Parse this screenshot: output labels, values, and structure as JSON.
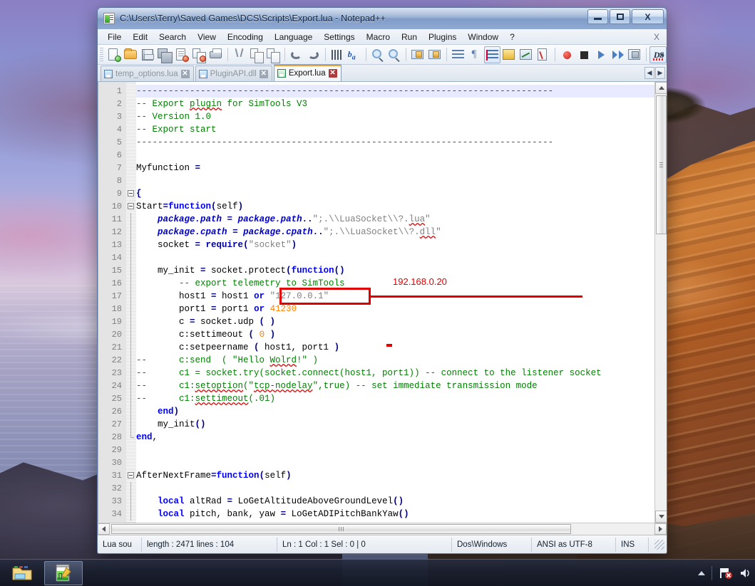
{
  "window": {
    "title": "C:\\Users\\Terry\\Saved Games\\DCS\\Scripts\\Export.lua - Notepad++",
    "doc_icon": "notepad-plus-plus-document-icon",
    "minimize": "–",
    "maximize": "❑",
    "close": "X"
  },
  "menu": {
    "items": [
      {
        "label": "File"
      },
      {
        "label": "Edit"
      },
      {
        "label": "Search"
      },
      {
        "label": "View"
      },
      {
        "label": "Encoding"
      },
      {
        "label": "Language"
      },
      {
        "label": "Settings"
      },
      {
        "label": "Macro"
      },
      {
        "label": "Run"
      },
      {
        "label": "Plugins"
      },
      {
        "label": "Window"
      },
      {
        "label": "?"
      }
    ],
    "close_doc": "X"
  },
  "toolbar": {
    "overflow": "»",
    "buttons": [
      {
        "name": "new-file-icon"
      },
      {
        "name": "open-file-icon"
      },
      {
        "name": "save-icon"
      },
      {
        "name": "save-all-icon"
      },
      {
        "name": "close-file-icon"
      },
      {
        "name": "close-all-files-icon"
      },
      {
        "name": "print-icon"
      },
      {
        "name": "cut-icon"
      },
      {
        "name": "copy-icon"
      },
      {
        "name": "paste-icon"
      },
      {
        "name": "undo-icon"
      },
      {
        "name": "redo-icon"
      },
      {
        "name": "find-icon"
      },
      {
        "name": "replace-icon"
      },
      {
        "name": "zoom-in-icon"
      },
      {
        "name": "zoom-out-icon"
      },
      {
        "name": "sync-vertical-scroll-icon"
      },
      {
        "name": "sync-horizontal-scroll-icon"
      },
      {
        "name": "word-wrap-icon"
      },
      {
        "name": "show-all-characters-icon"
      },
      {
        "name": "indent-guide-icon"
      },
      {
        "name": "user-defined-dialog-icon"
      },
      {
        "name": "document-map-icon"
      },
      {
        "name": "function-list-icon"
      },
      {
        "name": "start-recording-icon"
      },
      {
        "name": "stop-recording-icon"
      },
      {
        "name": "play-macro-icon"
      },
      {
        "name": "run-macro-multiple-icon"
      },
      {
        "name": "save-macro-icon"
      },
      {
        "name": "ds-plugin-icon"
      }
    ],
    "ds_label": "DS"
  },
  "tabs": {
    "items": [
      {
        "label": "temp_options.lua",
        "active": false,
        "close": "✕"
      },
      {
        "label": "PluginAPI.dll",
        "active": false,
        "close": "✕"
      },
      {
        "label": "Export.lua",
        "active": true,
        "close": "✕"
      }
    ],
    "nav_prev": "◀",
    "nav_next": "▶"
  },
  "editor": {
    "first_line": 1,
    "caret_line": 1,
    "lines": [
      {
        "n": 1,
        "fold": "none",
        "tokens": [
          {
            "t": "comment",
            "s": "------------------------------------------------------------------------------"
          }
        ]
      },
      {
        "n": 2,
        "fold": "none",
        "tokens": [
          {
            "t": "comment",
            "s": "-- Export "
          },
          {
            "t": "comment-spell",
            "s": "plugin"
          },
          {
            "t": "comment",
            "s": " for SimTools V3"
          }
        ]
      },
      {
        "n": 3,
        "fold": "none",
        "tokens": [
          {
            "t": "comment",
            "s": "-- Version 1.0"
          }
        ]
      },
      {
        "n": 4,
        "fold": "none",
        "tokens": [
          {
            "t": "comment",
            "s": "-- Export start"
          }
        ]
      },
      {
        "n": 5,
        "fold": "none",
        "tokens": [
          {
            "t": "comment",
            "s": "------------------------------------------------------------------------------"
          }
        ]
      },
      {
        "n": 6,
        "fold": "none",
        "tokens": []
      },
      {
        "n": 7,
        "fold": "none",
        "tokens": [
          {
            "t": "plain",
            "s": "Myfunction "
          },
          {
            "t": "op",
            "s": "="
          }
        ]
      },
      {
        "n": 8,
        "fold": "none",
        "tokens": []
      },
      {
        "n": 9,
        "fold": "open",
        "tokens": [
          {
            "t": "op",
            "s": "{"
          }
        ]
      },
      {
        "n": 10,
        "fold": "open",
        "tokens": [
          {
            "t": "plain",
            "s": "Start"
          },
          {
            "t": "op",
            "s": "="
          },
          {
            "t": "keyword",
            "s": "function"
          },
          {
            "t": "op",
            "s": "("
          },
          {
            "t": "plain",
            "s": "self"
          },
          {
            "t": "op",
            "s": ")"
          }
        ]
      },
      {
        "n": 11,
        "fold": "line",
        "tokens": [
          {
            "t": "plain",
            "s": "    "
          },
          {
            "t": "ident-bi",
            "s": "package.path"
          },
          {
            "t": "plain",
            "s": " "
          },
          {
            "t": "op",
            "s": "="
          },
          {
            "t": "plain",
            "s": " "
          },
          {
            "t": "ident-bi",
            "s": "package.path"
          },
          {
            "t": "op",
            "s": ".."
          },
          {
            "t": "str",
            "s": "\";.\\\\LuaSocket\\\\?."
          },
          {
            "t": "str-spell",
            "s": "lua"
          },
          {
            "t": "str",
            "s": "\""
          }
        ]
      },
      {
        "n": 12,
        "fold": "line",
        "tokens": [
          {
            "t": "plain",
            "s": "    "
          },
          {
            "t": "ident-bi",
            "s": "package.cpath"
          },
          {
            "t": "plain",
            "s": " "
          },
          {
            "t": "op",
            "s": "="
          },
          {
            "t": "plain",
            "s": " "
          },
          {
            "t": "ident-bi",
            "s": "package.cpath"
          },
          {
            "t": "op",
            "s": ".."
          },
          {
            "t": "str",
            "s": "\";.\\\\LuaSocket\\\\?."
          },
          {
            "t": "str-spell",
            "s": "dll"
          },
          {
            "t": "str",
            "s": "\""
          }
        ]
      },
      {
        "n": 13,
        "fold": "line",
        "tokens": [
          {
            "t": "plain",
            "s": "    socket "
          },
          {
            "t": "op",
            "s": "="
          },
          {
            "t": "plain",
            "s": " "
          },
          {
            "t": "func",
            "s": "require"
          },
          {
            "t": "op",
            "s": "("
          },
          {
            "t": "str",
            "s": "\"socket\""
          },
          {
            "t": "op",
            "s": ")"
          }
        ]
      },
      {
        "n": 14,
        "fold": "line",
        "tokens": []
      },
      {
        "n": 15,
        "fold": "line",
        "tokens": [
          {
            "t": "plain",
            "s": "    my_init "
          },
          {
            "t": "op",
            "s": "="
          },
          {
            "t": "plain",
            "s": " socket.protect"
          },
          {
            "t": "op",
            "s": "("
          },
          {
            "t": "keyword",
            "s": "function"
          },
          {
            "t": "op",
            "s": "()"
          }
        ]
      },
      {
        "n": 16,
        "fold": "line",
        "tokens": [
          {
            "t": "plain",
            "s": "        "
          },
          {
            "t": "comment",
            "s": "-- export telemetry to SimTools"
          }
        ]
      },
      {
        "n": 17,
        "fold": "line",
        "tokens": [
          {
            "t": "plain",
            "s": "        host1 "
          },
          {
            "t": "op",
            "s": "="
          },
          {
            "t": "plain",
            "s": " host1 "
          },
          {
            "t": "keyword",
            "s": "or"
          },
          {
            "t": "plain",
            "s": " "
          },
          {
            "t": "str",
            "s": "\"127.0.0.1\""
          }
        ]
      },
      {
        "n": 18,
        "fold": "line",
        "tokens": [
          {
            "t": "plain",
            "s": "        port1 "
          },
          {
            "t": "op",
            "s": "="
          },
          {
            "t": "plain",
            "s": " port1 "
          },
          {
            "t": "keyword",
            "s": "or"
          },
          {
            "t": "plain",
            "s": " "
          },
          {
            "t": "num",
            "s": "41230"
          }
        ]
      },
      {
        "n": 19,
        "fold": "line",
        "tokens": [
          {
            "t": "plain",
            "s": "        c "
          },
          {
            "t": "op",
            "s": "="
          },
          {
            "t": "plain",
            "s": " socket.udp "
          },
          {
            "t": "op",
            "s": "( )"
          }
        ]
      },
      {
        "n": 20,
        "fold": "line",
        "tokens": [
          {
            "t": "plain",
            "s": "        c:settimeout "
          },
          {
            "t": "op",
            "s": "("
          },
          {
            "t": "plain",
            "s": " "
          },
          {
            "t": "num",
            "s": "0"
          },
          {
            "t": "plain",
            "s": " "
          },
          {
            "t": "op",
            "s": ")"
          }
        ]
      },
      {
        "n": 21,
        "fold": "line",
        "tokens": [
          {
            "t": "plain",
            "s": "        c:setpeername "
          },
          {
            "t": "op",
            "s": "("
          },
          {
            "t": "plain",
            "s": " host1, port1 "
          },
          {
            "t": "op",
            "s": ")"
          }
        ]
      },
      {
        "n": 22,
        "fold": "line",
        "tokens": [
          {
            "t": "comment",
            "s": "--      c:send  ( \"Hello "
          },
          {
            "t": "comment-spell",
            "s": "Wolrd"
          },
          {
            "t": "comment",
            "s": "!\" )"
          }
        ]
      },
      {
        "n": 23,
        "fold": "line",
        "tokens": [
          {
            "t": "comment",
            "s": "--      c1 = socket.try(socket.connect(host1, port1)) -- connect to the listener socket"
          }
        ]
      },
      {
        "n": 24,
        "fold": "line",
        "tokens": [
          {
            "t": "comment",
            "s": "--      c1:"
          },
          {
            "t": "comment-spell",
            "s": "setoption"
          },
          {
            "t": "comment",
            "s": "(\""
          },
          {
            "t": "comment-spell",
            "s": "tcp-nodelay"
          },
          {
            "t": "comment",
            "s": "\",true) -- set immediate transmission mode"
          }
        ]
      },
      {
        "n": 25,
        "fold": "line",
        "tokens": [
          {
            "t": "comment",
            "s": "--      c1:"
          },
          {
            "t": "comment-spell",
            "s": "settimeout"
          },
          {
            "t": "comment",
            "s": "(.01)"
          }
        ]
      },
      {
        "n": 26,
        "fold": "line",
        "tokens": [
          {
            "t": "plain",
            "s": "    "
          },
          {
            "t": "keyword",
            "s": "end"
          },
          {
            "t": "op",
            "s": ")"
          }
        ]
      },
      {
        "n": 27,
        "fold": "line",
        "tokens": [
          {
            "t": "plain",
            "s": "    my_init"
          },
          {
            "t": "op",
            "s": "()"
          }
        ]
      },
      {
        "n": 28,
        "fold": "end",
        "tokens": [
          {
            "t": "keyword",
            "s": "end"
          },
          {
            "t": "plain",
            "s": ","
          }
        ]
      },
      {
        "n": 29,
        "fold": "none",
        "tokens": []
      },
      {
        "n": 30,
        "fold": "none",
        "tokens": []
      },
      {
        "n": 31,
        "fold": "open",
        "tokens": [
          {
            "t": "plain",
            "s": "AfterNextFrame"
          },
          {
            "t": "op",
            "s": "="
          },
          {
            "t": "keyword",
            "s": "function"
          },
          {
            "t": "op",
            "s": "("
          },
          {
            "t": "plain",
            "s": "self"
          },
          {
            "t": "op",
            "s": ")"
          }
        ]
      },
      {
        "n": 32,
        "fold": "line",
        "tokens": []
      },
      {
        "n": 33,
        "fold": "line",
        "tokens": [
          {
            "t": "plain",
            "s": "    "
          },
          {
            "t": "keyword",
            "s": "local"
          },
          {
            "t": "plain",
            "s": " altRad "
          },
          {
            "t": "op",
            "s": "="
          },
          {
            "t": "plain",
            "s": " LoGetAltitudeAboveGroundLevel"
          },
          {
            "t": "op",
            "s": "()"
          }
        ]
      },
      {
        "n": 34,
        "fold": "line",
        "tokens": [
          {
            "t": "plain",
            "s": "    "
          },
          {
            "t": "keyword",
            "s": "local"
          },
          {
            "t": "plain",
            "s": " pitch, bank, yaw "
          },
          {
            "t": "op",
            "s": "="
          },
          {
            "t": "plain",
            "s": " LoGetADIPitchBankYaw"
          },
          {
            "t": "op",
            "s": "()"
          }
        ]
      }
    ]
  },
  "annotation": {
    "text": "192.168.0.20",
    "color": "#e00000",
    "highlights": "\"127.0.0.1\""
  },
  "statusbar": {
    "language": "Lua sou",
    "length_lines": "length : 2471    lines : 104",
    "caret": "Ln : 1    Col : 1    Sel : 0 | 0",
    "eol": "Dos\\Windows",
    "encoding": "ANSI as UTF-8",
    "insert_mode": "INS"
  },
  "taskbar": {
    "items": [
      {
        "name": "file-explorer-icon",
        "active": false
      },
      {
        "name": "notepad-plus-plus-icon",
        "active": true
      }
    ],
    "tray": {
      "show_hidden": "show-hidden-icons-chevron",
      "network": "network-disconnected-icon",
      "volume": "volume-icon"
    }
  }
}
